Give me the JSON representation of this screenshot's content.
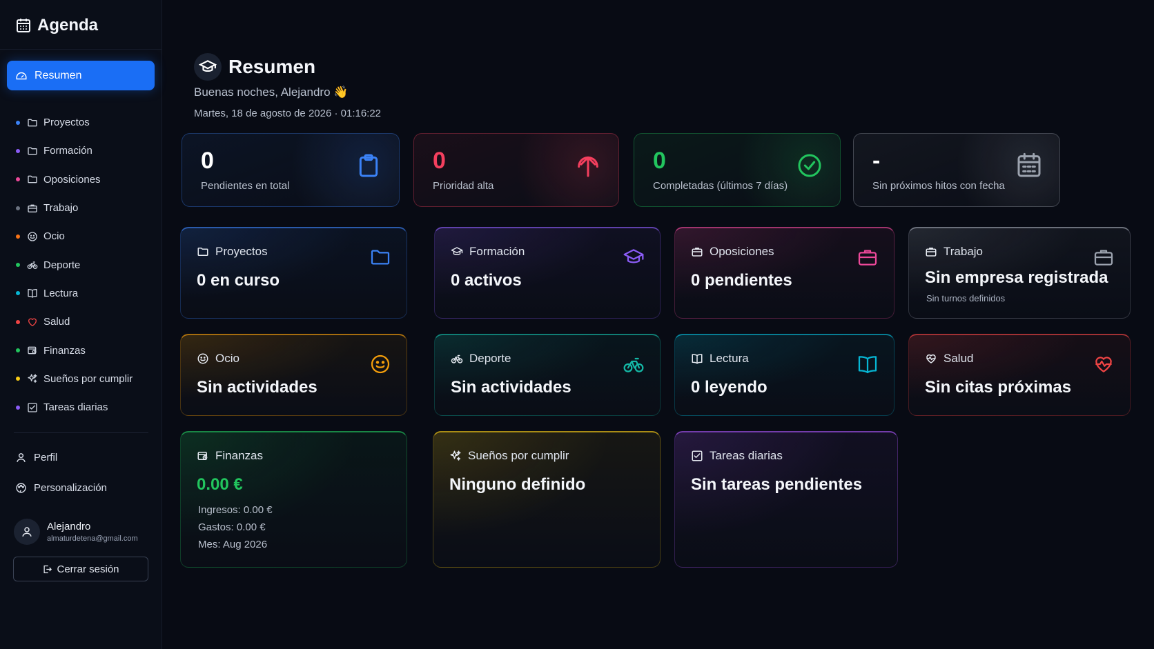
{
  "app": {
    "title": "Agenda"
  },
  "sidebar": {
    "active": {
      "label": "Resumen"
    },
    "items": [
      {
        "label": "Proyectos",
        "color": "#3b82f6",
        "icon": "folder-icon"
      },
      {
        "label": "Formación",
        "color": "#8b5cf6",
        "icon": "folder-icon"
      },
      {
        "label": "Oposiciones",
        "color": "#ec4899",
        "icon": "folder-icon"
      },
      {
        "label": "Trabajo",
        "color": "#6b7280",
        "icon": "briefcase-icon"
      },
      {
        "label": "Ocio",
        "color": "#f97316",
        "icon": "smile-icon"
      },
      {
        "label": "Deporte",
        "color": "#22c55e",
        "icon": "bike-icon"
      },
      {
        "label": "Lectura",
        "color": "#06b6d4",
        "icon": "book-icon"
      },
      {
        "label": "Salud",
        "color": "#ef4444",
        "icon": "heart-icon"
      },
      {
        "label": "Finanzas",
        "color": "#22c55e",
        "icon": "wallet-icon"
      },
      {
        "label": "Sueños por cumplir",
        "color": "#facc15",
        "icon": "sparkles-icon"
      },
      {
        "label": "Tareas diarias",
        "color": "#8b5cf6",
        "icon": "checkbox-icon"
      }
    ],
    "profile": "Perfil",
    "settings": "Personalización",
    "user": {
      "name": "Alejandro",
      "email": "almaturdetena@gmail.com"
    },
    "logout": "Cerrar sesión"
  },
  "header": {
    "title": "Resumen",
    "greeting": "Buenas noches, Alejandro 👋",
    "datetime": "Martes, 18 de agosto de 2026 · 01:16:22"
  },
  "stats": [
    {
      "value": "0",
      "label": "Pendientes en total",
      "color": "#ffffff",
      "accent": "#3b82f6",
      "icon": "clipboard-icon"
    },
    {
      "value": "0",
      "label": "Prioridad alta",
      "color": "#f43f5e",
      "accent": "#f43f5e",
      "icon": "arrow-up-icon"
    },
    {
      "value": "0",
      "label": "Completadas (últimos 7 días)",
      "color": "#22c55e",
      "accent": "#22c55e",
      "icon": "check-circle-icon"
    },
    {
      "value": "-",
      "label": "Sin próximos hitos con fecha",
      "color": "#ffffff",
      "accent": "#9ca3af",
      "icon": "calendar-icon"
    }
  ],
  "tiles": [
    {
      "title": "Proyectos",
      "value": "0 en curso",
      "accent": "#3b82f6",
      "icon": "folder-icon"
    },
    {
      "title": "Formación",
      "value": "0 activos",
      "accent": "#8b5cf6",
      "icon": "graduation-cap-icon"
    },
    {
      "title": "Oposiciones",
      "value": "0 pendientes",
      "accent": "#ec4899",
      "icon": "briefcase-icon"
    },
    {
      "title": "Trabajo",
      "value": "Sin empresa registrada",
      "sub": "Sin turnos definidos",
      "accent": "#9ca3af",
      "icon": "briefcase-icon"
    },
    {
      "title": "Ocio",
      "value": "Sin actividades",
      "accent": "#f59e0b",
      "icon": "smile-icon"
    },
    {
      "title": "Deporte",
      "value": "Sin actividades",
      "accent": "#14b8a6",
      "icon": "bike-icon"
    },
    {
      "title": "Lectura",
      "value": "0 leyendo",
      "accent": "#06b6d4",
      "icon": "book-icon"
    },
    {
      "title": "Salud",
      "value": "Sin citas próximas",
      "accent": "#ef4444",
      "icon": "heart-pulse-icon"
    },
    {
      "title": "Finanzas",
      "value": "0.00 €",
      "accent": "#22c55e",
      "icon": "wallet-icon",
      "lines": [
        "Ingresos: 0.00 €",
        "Gastos: 0.00 €",
        "Mes: Aug 2026"
      ]
    },
    {
      "title": "Sueños por cumplir",
      "value": "Ninguno definido",
      "accent": "#facc15",
      "icon": "sparkles-icon"
    },
    {
      "title": "Tareas diarias",
      "value": "Sin tareas pendientes",
      "accent": "#a855f7",
      "icon": "checkbox-icon"
    }
  ]
}
